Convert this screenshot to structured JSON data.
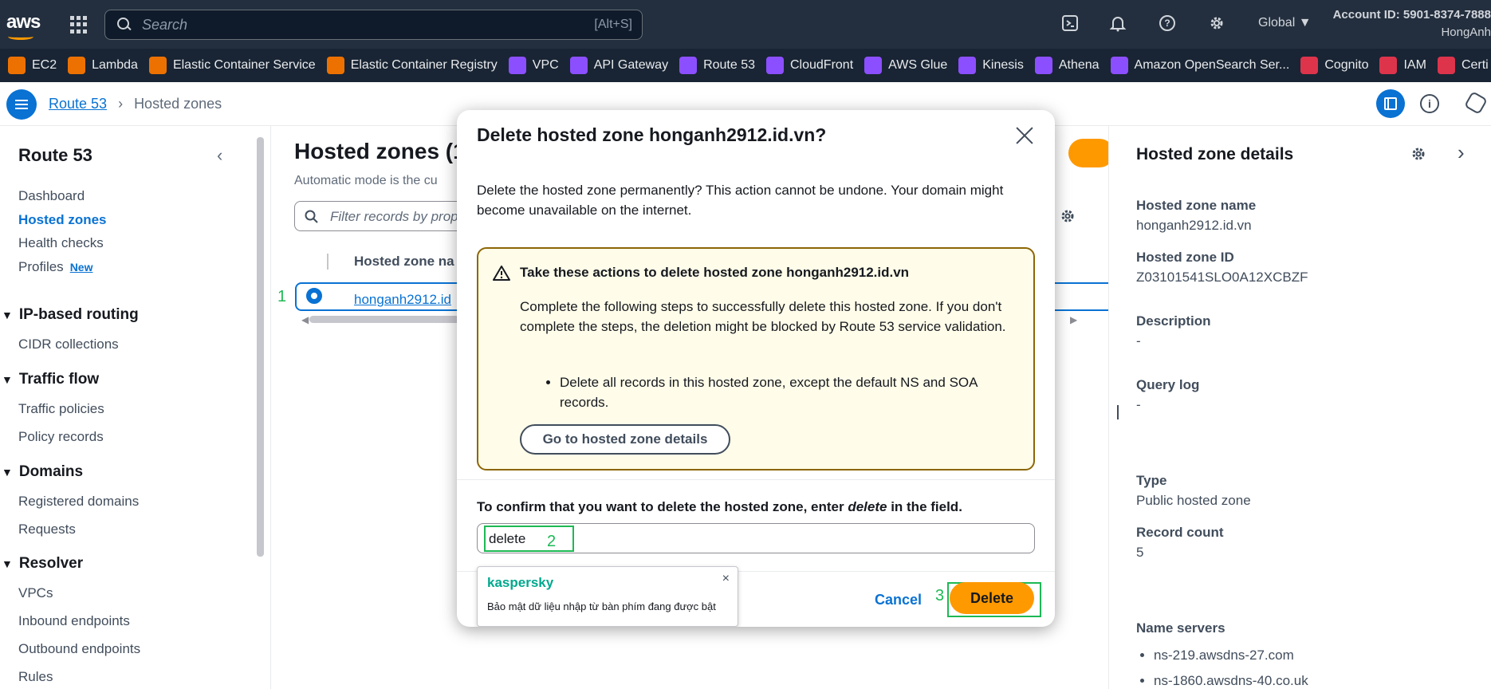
{
  "topnav": {
    "logo": "aws",
    "search_placeholder": "Search",
    "search_shortcut": "[Alt+S]",
    "region": "Global ▼",
    "account_id": "Account ID: 5901-8374-7888",
    "user": "HongAnh"
  },
  "favorites": [
    {
      "label": "EC2",
      "color": "#ed7100"
    },
    {
      "label": "Lambda",
      "color": "#ed7100"
    },
    {
      "label": "Elastic Container Service",
      "color": "#ed7100"
    },
    {
      "label": "Elastic Container Registry",
      "color": "#ed7100"
    },
    {
      "label": "VPC",
      "color": "#8c4fff"
    },
    {
      "label": "API Gateway",
      "color": "#8c4fff"
    },
    {
      "label": "Route 53",
      "color": "#8c4fff"
    },
    {
      "label": "CloudFront",
      "color": "#8c4fff"
    },
    {
      "label": "AWS Glue",
      "color": "#8c4fff"
    },
    {
      "label": "Kinesis",
      "color": "#8c4fff"
    },
    {
      "label": "Athena",
      "color": "#8c4fff"
    },
    {
      "label": "Amazon OpenSearch Ser...",
      "color": "#8c4fff"
    },
    {
      "label": "Cognito",
      "color": "#dd344c"
    },
    {
      "label": "IAM",
      "color": "#dd344c"
    },
    {
      "label": "Certi",
      "color": "#dd344c"
    }
  ],
  "breadcrumb": {
    "root": "Route 53",
    "current": "Hosted zones"
  },
  "sidenav": {
    "title": "Route 53",
    "items": [
      "Dashboard",
      "Hosted zones",
      "Health checks",
      "Profiles"
    ],
    "new_badge": "New",
    "sections": [
      {
        "title": "IP-based routing",
        "items": [
          "CIDR collections"
        ]
      },
      {
        "title": "Traffic flow",
        "items": [
          "Traffic policies",
          "Policy records"
        ]
      },
      {
        "title": "Domains",
        "items": [
          "Registered domains",
          "Requests"
        ]
      },
      {
        "title": "Resolver",
        "items": [
          "VPCs",
          "Inbound endpoints",
          "Outbound endpoints",
          "Rules"
        ]
      }
    ]
  },
  "main": {
    "title": "Hosted zones (1",
    "desc": "Automatic mode is the cu",
    "filter_placeholder": "Filter records by prope",
    "col_header": "Hosted zone na",
    "row_link": "honganh2912.id",
    "annotation_1": "1"
  },
  "details": {
    "title": "Hosted zone details",
    "fields": [
      {
        "label": "Hosted zone name",
        "value": "honganh2912.id.vn"
      },
      {
        "label": "Hosted zone ID",
        "value": "Z03101541SLO0A12XCBZF"
      },
      {
        "label": "Description",
        "value": "-"
      },
      {
        "label": "Query log",
        "value": "-"
      },
      {
        "label": "Type",
        "value": "Public hosted zone"
      },
      {
        "label": "Record count",
        "value": "5"
      },
      {
        "label": "Name servers",
        "value": ""
      }
    ],
    "name_servers": [
      "ns-219.awsdns-27.com",
      "ns-1860.awsdns-40.co.uk"
    ]
  },
  "modal": {
    "title": "Delete hosted zone honganh2912.id.vn?",
    "lead": "Delete the hosted zone permanently? This action cannot be undone. Your domain might become unavailable on the internet.",
    "warn_title": "Take these actions to delete hosted zone honganh2912.id.vn",
    "warn_text": "Complete the following steps to successfully delete this hosted zone. If you don't complete the steps, the deletion might be blocked by Route 53 service validation.",
    "warn_bullet": "Delete all records in this hosted zone, except the default NS and SOA records.",
    "go_button": "Go to hosted zone details",
    "confirm_prefix": "To confirm that you want to delete the hosted zone, enter ",
    "confirm_word": "delete",
    "confirm_suffix": " in the field.",
    "input_value": "delete",
    "annotation_2": "2",
    "annotation_3": "3",
    "cancel": "Cancel",
    "delete": "Delete"
  },
  "kaspersky": {
    "brand": "kaspersky",
    "text": "Bảo mật dữ liệu nhập từ bàn phím đang được bật",
    "close": "×"
  },
  "colors": {
    "accent": "#0972d3",
    "primary_button": "#ff9900",
    "annotation": "#1db954",
    "warning_border": "#8d6605"
  }
}
